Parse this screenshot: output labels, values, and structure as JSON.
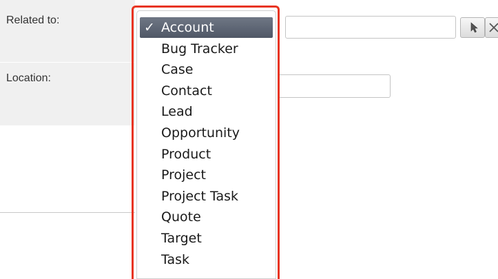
{
  "form": {
    "related_label": "Related to:",
    "location_label": "Location:",
    "related_input_value": "",
    "location_input_value": ""
  },
  "dropdown": {
    "check_mark": "✓",
    "selected_index": 0,
    "options": [
      "Account",
      "Bug Tracker",
      "Case",
      "Contact",
      "Lead",
      "Opportunity",
      "Product",
      "Project",
      "Project Task",
      "Quote",
      "Target",
      "Task"
    ]
  },
  "colors": {
    "highlight_frame": "#e8341f",
    "selected_option_bg": "#5f6775",
    "label_cell_bg": "#f0f0f0"
  },
  "icons": {
    "select_button": "cursor-arrow-icon",
    "clear_button": "close-x-icon"
  }
}
